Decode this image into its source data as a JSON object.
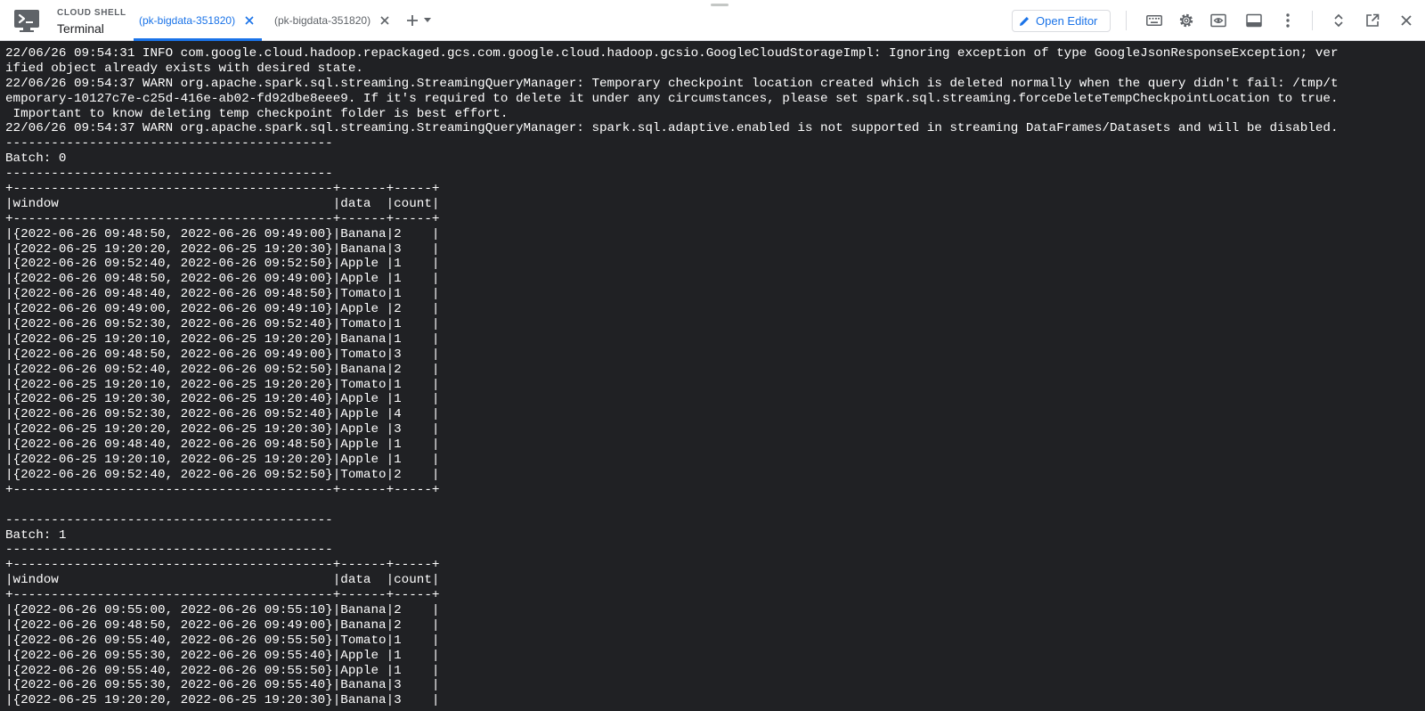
{
  "header": {
    "product_name": "CLOUD SHELL",
    "section_name": "Terminal"
  },
  "tabs": [
    {
      "label": "(pk-bigdata-351820)",
      "active": true
    },
    {
      "label": "(pk-bigdata-351820)",
      "active": false
    }
  ],
  "toolbar": {
    "open_editor_label": "Open Editor",
    "icons": [
      "keyboard-icon",
      "settings-icon",
      "web-preview-icon",
      "terminal-layout-icon",
      "more-vert-icon",
      "restore-size-icon",
      "open-new-window-icon",
      "close-icon"
    ]
  },
  "colors": {
    "accent": "#1a73e8",
    "terminal_background": "#202124",
    "terminal_text": "#ffffff"
  },
  "terminal": {
    "lines": [
      "22/06/26 09:54:31 INFO com.google.cloud.hadoop.repackaged.gcs.com.google.cloud.hadoop.gcsio.GoogleCloudStorageImpl: Ignoring exception of type GoogleJsonResponseException; ver",
      "ified object already exists with desired state.",
      "22/06/26 09:54:37 WARN org.apache.spark.sql.streaming.StreamingQueryManager: Temporary checkpoint location created which is deleted normally when the query didn't fail: /tmp/t",
      "emporary-10127c7e-c25d-416e-ab02-fd92dbe8eee9. If it's required to delete it under any circumstances, please set spark.sql.streaming.forceDeleteTempCheckpointLocation to true.",
      " Important to know deleting temp checkpoint folder is best effort.",
      "22/06/26 09:54:37 WARN org.apache.spark.sql.streaming.StreamingQueryManager: spark.sql.adaptive.enabled is not supported in streaming DataFrames/Datasets and will be disabled.",
      "-------------------------------------------",
      "Batch: 0",
      "-------------------------------------------",
      "+------------------------------------------+------+-----+",
      "|window                                    |data  |count|",
      "+------------------------------------------+------+-----+",
      "|{2022-06-26 09:48:50, 2022-06-26 09:49:00}|Banana|2    |",
      "|{2022-06-25 19:20:20, 2022-06-25 19:20:30}|Banana|3    |",
      "|{2022-06-26 09:52:40, 2022-06-26 09:52:50}|Apple |1    |",
      "|{2022-06-26 09:48:50, 2022-06-26 09:49:00}|Apple |1    |",
      "|{2022-06-26 09:48:40, 2022-06-26 09:48:50}|Tomato|1    |",
      "|{2022-06-26 09:49:00, 2022-06-26 09:49:10}|Apple |2    |",
      "|{2022-06-26 09:52:30, 2022-06-26 09:52:40}|Tomato|1    |",
      "|{2022-06-25 19:20:10, 2022-06-25 19:20:20}|Banana|1    |",
      "|{2022-06-26 09:48:50, 2022-06-26 09:49:00}|Tomato|3    |",
      "|{2022-06-26 09:52:40, 2022-06-26 09:52:50}|Banana|2    |",
      "|{2022-06-25 19:20:10, 2022-06-25 19:20:20}|Tomato|1    |",
      "|{2022-06-25 19:20:30, 2022-06-25 19:20:40}|Apple |1    |",
      "|{2022-06-26 09:52:30, 2022-06-26 09:52:40}|Apple |4    |",
      "|{2022-06-25 19:20:20, 2022-06-25 19:20:30}|Apple |3    |",
      "|{2022-06-26 09:48:40, 2022-06-26 09:48:50}|Apple |1    |",
      "|{2022-06-25 19:20:10, 2022-06-25 19:20:20}|Apple |1    |",
      "|{2022-06-26 09:52:40, 2022-06-26 09:52:50}|Tomato|2    |",
      "+------------------------------------------+------+-----+",
      "",
      "-------------------------------------------",
      "Batch: 1",
      "-------------------------------------------",
      "+------------------------------------------+------+-----+",
      "|window                                    |data  |count|",
      "+------------------------------------------+------+-----+",
      "|{2022-06-26 09:55:00, 2022-06-26 09:55:10}|Banana|2    |",
      "|{2022-06-26 09:48:50, 2022-06-26 09:49:00}|Banana|2    |",
      "|{2022-06-26 09:55:40, 2022-06-26 09:55:50}|Tomato|1    |",
      "|{2022-06-26 09:55:30, 2022-06-26 09:55:40}|Apple |1    |",
      "|{2022-06-26 09:55:40, 2022-06-26 09:55:50}|Apple |1    |",
      "|{2022-06-26 09:55:30, 2022-06-26 09:55:40}|Banana|3    |",
      "|{2022-06-25 19:20:20, 2022-06-25 19:20:30}|Banana|3    |"
    ]
  }
}
